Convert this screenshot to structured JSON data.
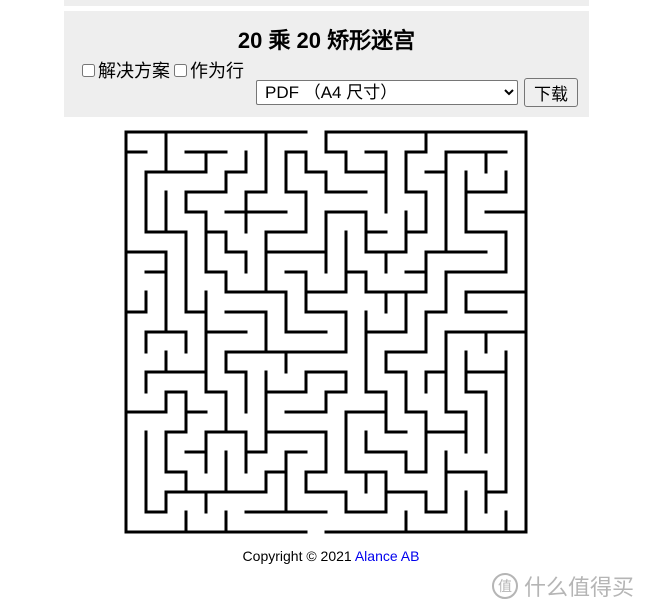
{
  "header": {
    "title": "20 乘 20 矫形迷宫"
  },
  "options": [
    {
      "label": "解决方案",
      "checked": false
    },
    {
      "label": "作为行",
      "checked": false
    }
  ],
  "format": {
    "selected": "PDF （A4 尺寸）"
  },
  "download_label": "下载",
  "footer": {
    "copyright": "Copyright © 2021",
    "company": "Alance AB"
  },
  "watermark": {
    "text": "什么值得买",
    "logo": "值"
  },
  "maze": {
    "rows": 20,
    "cols": 20,
    "seed": 20211
  }
}
